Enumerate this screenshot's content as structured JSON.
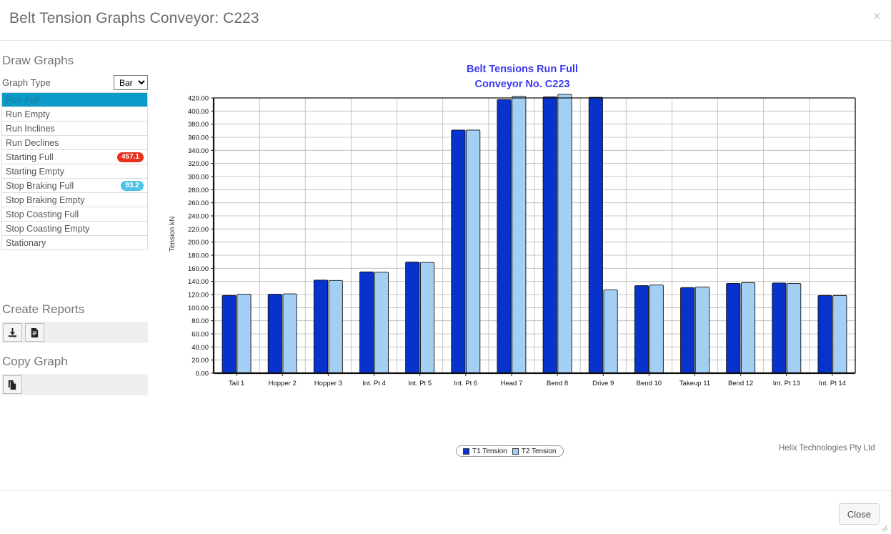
{
  "header": {
    "title": "Belt Tension Graphs Conveyor: C223",
    "close_x": "×"
  },
  "sidebar": {
    "draw_graphs_heading": "Draw Graphs",
    "graph_type_label": "Graph Type",
    "graph_type_value": "Bar",
    "graph_type_options": [
      "Bar"
    ],
    "items": [
      {
        "label": "Run Full",
        "selected": true,
        "badge": null,
        "badge_kind": null
      },
      {
        "label": "Run Empty",
        "selected": false,
        "badge": null,
        "badge_kind": null
      },
      {
        "label": "Run Inclines",
        "selected": false,
        "badge": null,
        "badge_kind": null
      },
      {
        "label": "Run Declines",
        "selected": false,
        "badge": null,
        "badge_kind": null
      },
      {
        "label": "Starting Full",
        "selected": false,
        "badge": "457.1",
        "badge_kind": "danger"
      },
      {
        "label": "Starting Empty",
        "selected": false,
        "badge": null,
        "badge_kind": null
      },
      {
        "label": "Stop Braking Full",
        "selected": false,
        "badge": "93.2",
        "badge_kind": "info"
      },
      {
        "label": "Stop Braking Empty",
        "selected": false,
        "badge": null,
        "badge_kind": null
      },
      {
        "label": "Stop Coasting Full",
        "selected": false,
        "badge": null,
        "badge_kind": null
      },
      {
        "label": "Stop Coasting Empty",
        "selected": false,
        "badge": null,
        "badge_kind": null
      },
      {
        "label": "Stationary",
        "selected": false,
        "badge": null,
        "badge_kind": null
      }
    ],
    "create_reports_heading": "Create Reports",
    "copy_graph_heading": "Copy Graph",
    "create_reports_buttons": [
      {
        "name": "download-report-icon",
        "title": "Download Report"
      },
      {
        "name": "document-report-icon",
        "title": "Create Document Report"
      }
    ],
    "copy_graph_buttons": [
      {
        "name": "copy-icon",
        "title": "Copy Graph"
      }
    ]
  },
  "chart_data": {
    "type": "bar",
    "title": "Belt Tensions Run Full",
    "subtitle": "Conveyor No. C223",
    "title_color": "#3b38f0",
    "xlabel": "",
    "ylabel": "Tension  kN",
    "ylim": [
      0,
      420
    ],
    "ytick_step": 20,
    "ytick_format": "0.00",
    "yticks": [
      0,
      20,
      40,
      60,
      80,
      100,
      120,
      140,
      160,
      180,
      200,
      220,
      240,
      260,
      280,
      300,
      320,
      340,
      360,
      380,
      400,
      420
    ],
    "ytick_labels": [
      "0.00",
      "20.00",
      "40.00",
      "60.00",
      "80.00",
      "100.00",
      "120.00",
      "140.00",
      "160.00",
      "180.00",
      "200.00",
      "220.00",
      "240.00",
      "260.00",
      "280.00",
      "300.00",
      "320.00",
      "340.00",
      "360.00",
      "380.00",
      "400.00",
      "420.00"
    ],
    "grid": true,
    "legend_position": "bottom",
    "categories": [
      "Tail 1",
      "Hopper 2",
      "Hopper 3",
      "Int. Pt 4",
      "Int. Pt 5",
      "Int. Pt 6",
      "Head 7",
      "Bend 8",
      "Drive 9",
      "Bend 10",
      "Takeup 11",
      "Bend 12",
      "Int. Pt 13",
      "Int. Pt 14"
    ],
    "series": [
      {
        "name": "T1 Tension",
        "color": "#0733cc",
        "values": [
          118.5,
          120.5,
          142.0,
          154.5,
          169.5,
          371.0,
          417.5,
          421.5,
          421.0,
          133.5,
          130.5,
          137.0,
          137.5,
          118.5
        ]
      },
      {
        "name": "T2 Tension",
        "color": "#a3cff5",
        "values": [
          120.5,
          121.0,
          141.5,
          154.0,
          169.0,
          371.0,
          422.5,
          425.5,
          127.0,
          134.5,
          131.5,
          138.0,
          137.0,
          118.5
        ]
      }
    ]
  },
  "footer": {
    "brand": "Helix Technologies Pty Ltd",
    "close_label": "Close"
  }
}
